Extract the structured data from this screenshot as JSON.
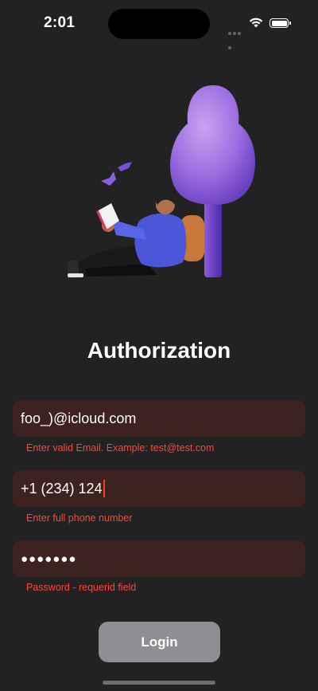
{
  "status_bar": {
    "time": "2:01"
  },
  "screen": {
    "title": "Authorization"
  },
  "form": {
    "email": {
      "value": "foo_)@icloud.com",
      "error": "Enter valid Email. Example: test@test.com"
    },
    "phone": {
      "value": "+1 (234) 124",
      "error": "Enter full phone number"
    },
    "password": {
      "masked_value": "●●●●●●●",
      "error": "Password - requerid field"
    }
  },
  "actions": {
    "login_label": "Login"
  },
  "colors": {
    "background": "#222222",
    "field_background": "#3e2220",
    "error": "#ff453a",
    "button": "#8e8e93"
  }
}
